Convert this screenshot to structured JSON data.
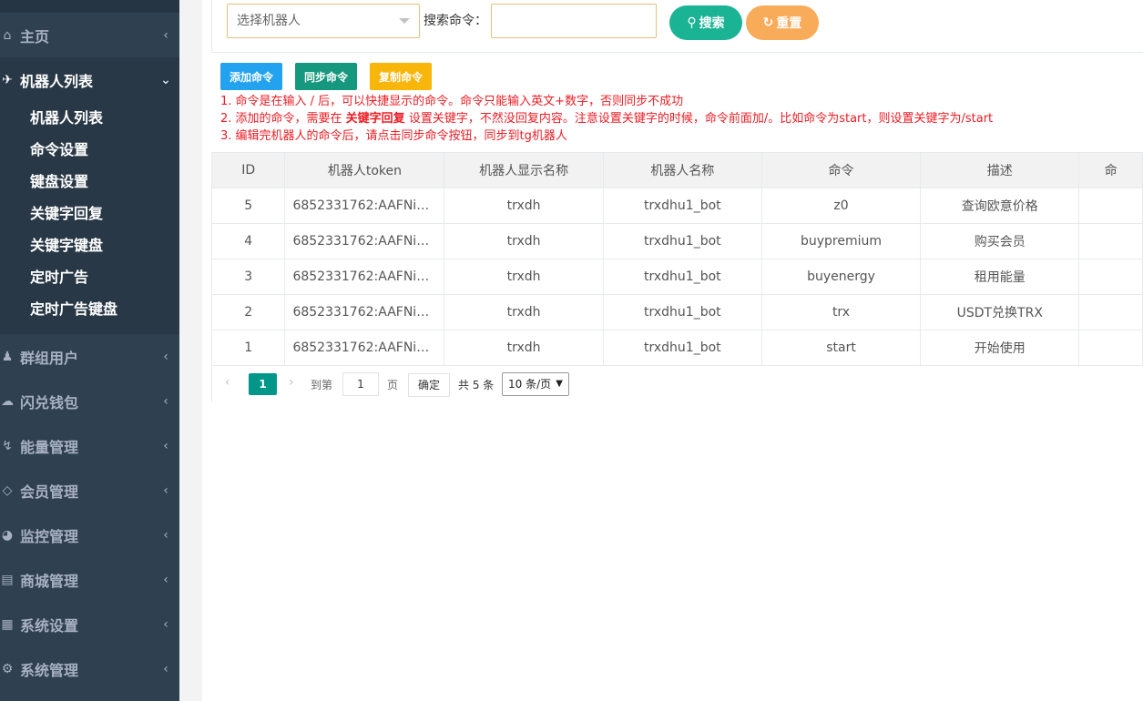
{
  "sidebar": {
    "items": [
      {
        "label": "主页",
        "icon": "home-icon"
      },
      {
        "label": "机器人列表",
        "icon": "plane-icon"
      },
      {
        "label": "群组用户",
        "icon": "users-icon"
      },
      {
        "label": "闪兑钱包",
        "icon": "cloud-icon"
      },
      {
        "label": "能量管理",
        "icon": "bolt-icon"
      },
      {
        "label": "会员管理",
        "icon": "diamond-icon"
      },
      {
        "label": "监控管理",
        "icon": "pie-icon"
      },
      {
        "label": "商城管理",
        "icon": "cart-icon"
      },
      {
        "label": "系统设置",
        "icon": "windows-icon"
      },
      {
        "label": "系统管理",
        "icon": "gear-icon"
      }
    ],
    "submenu": [
      "机器人列表",
      "命令设置",
      "键盘设置",
      "关键字回复",
      "关键字键盘",
      "定时广告",
      "定时广告键盘"
    ]
  },
  "search": {
    "select_placeholder": "选择机器人",
    "command_label": "搜索命令：",
    "command_value": "",
    "search_button": "搜索",
    "reset_button": "重置"
  },
  "toolbar": {
    "add": "添加命令",
    "sync": "同步命令",
    "copy": "复制命令"
  },
  "notes": {
    "line1": "1. 命令是在输入 / 后，可以快捷显示的命令。命令只能输入英文+数字，否则同步不成功",
    "line2_pre": "2. 添加的命令，需要在 ",
    "line2_bold": "关键字回复",
    "line2_post": " 设置关键字，不然没回复内容。注意设置关键字的时候，命令前面加/。比如命令为start，则设置关键字为/start",
    "line3": "3. 编辑完机器人的命令后，请点击同步命令按钮，同步到tg机器人"
  },
  "table": {
    "headers": [
      "ID",
      "机器人token",
      "机器人显示名称",
      "机器人名称",
      "命令",
      "描述",
      "命"
    ],
    "rows": [
      [
        "5",
        "6852331762:AAFNi3…",
        "trxdh",
        "trxdhu1_bot",
        "z0",
        "查询欧意价格",
        ""
      ],
      [
        "4",
        "6852331762:AAFNi3…",
        "trxdh",
        "trxdhu1_bot",
        "buypremium",
        "购买会员",
        ""
      ],
      [
        "3",
        "6852331762:AAFNi3…",
        "trxdh",
        "trxdhu1_bot",
        "buyenergy",
        "租用能量",
        ""
      ],
      [
        "2",
        "6852331762:AAFNi3…",
        "trxdh",
        "trxdhu1_bot",
        "trx",
        "USDT兑换TRX",
        ""
      ],
      [
        "1",
        "6852331762:AAFNi3…",
        "trxdh",
        "trxdhu1_bot",
        "start",
        "开始使用",
        ""
      ]
    ]
  },
  "pager": {
    "current": "1",
    "goto_label": "到第",
    "goto_value": "1",
    "page_label": "页",
    "confirm": "确定",
    "total": "共 5 条",
    "page_size": "10 条/页"
  }
}
